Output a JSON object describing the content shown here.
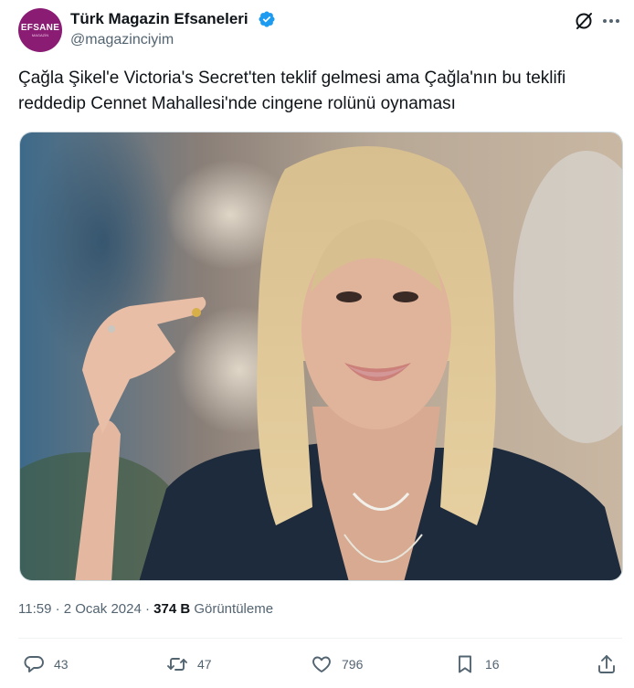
{
  "author": {
    "display_name": "Türk Magazin Efsaneleri",
    "handle": "@magazinciyim",
    "avatar_text": "EFSANE",
    "avatar_subtext": "MAGAZİN"
  },
  "tweet": {
    "text": "Çağla Şikel'e Victoria's Secret'ten teklif gelmesi ama Çağla'nın bu teklifi reddedip Cennet Mahallesi'nde cingene rolünü oynaması",
    "time": "11:59 · 2 Ocak 2024 · ",
    "views_count": "374 B",
    "views_label": " Görüntüleme"
  },
  "actions": {
    "replies": "43",
    "retweets": "47",
    "likes": "796",
    "bookmarks": "16"
  },
  "icons": {
    "verified": "verified-badge-icon",
    "grok": "grok-icon",
    "more": "more-icon",
    "reply": "reply-icon",
    "retweet": "retweet-icon",
    "like": "heart-icon",
    "bookmark": "bookmark-icon",
    "share": "share-icon"
  },
  "colors": {
    "verified": "#1d9bf0",
    "text": "#0f1419",
    "secondary": "#536471",
    "avatar_bg": "#8a1c74"
  }
}
